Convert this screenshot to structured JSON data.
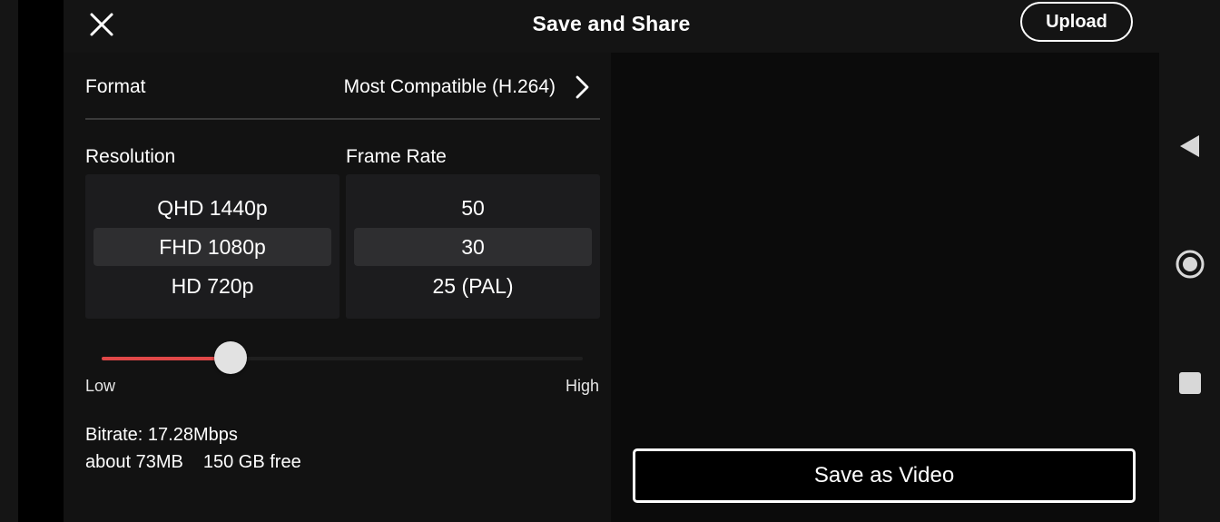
{
  "header": {
    "title": "Save and Share",
    "upload_label": "Upload",
    "close_icon": "close-icon"
  },
  "format": {
    "label": "Format",
    "value": "Most Compatible (H.264)",
    "icon": "chevron-right-icon"
  },
  "resolution": {
    "label": "Resolution",
    "options": [
      "QHD 1440p",
      "FHD 1080p",
      "HD 720p"
    ],
    "selected": "FHD 1080p"
  },
  "frame_rate": {
    "label": "Frame Rate",
    "options": [
      "50",
      "30",
      "25 (PAL)"
    ],
    "selected": "30"
  },
  "quality": {
    "low_label": "Low",
    "high_label": "High",
    "level": 0.25,
    "accent_color": "#e04848"
  },
  "stats": {
    "bitrate": "Bitrate: 17.28Mbps",
    "size": "about 73MB",
    "free": "150 GB free"
  },
  "actions": {
    "save_label": "Save as Video"
  },
  "system_nav": {
    "icons": [
      "back-triangle-icon",
      "home-circle-icon",
      "recents-square-icon"
    ]
  }
}
